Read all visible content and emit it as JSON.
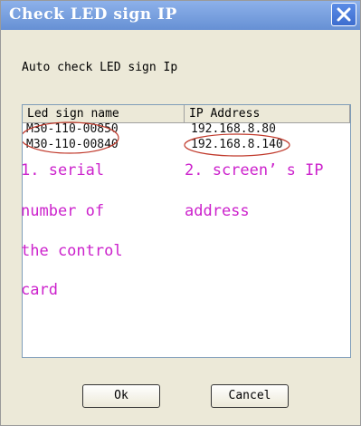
{
  "window": {
    "title": "Check LED sign IP"
  },
  "dialog": {
    "subtitle": "Auto check LED sign Ip"
  },
  "list": {
    "headers": [
      "Led sign name",
      "IP Address"
    ],
    "rows": [
      {
        "name": "M30-110-00850",
        "ip": "192.168.8.80"
      },
      {
        "name": "M30-110-00840",
        "ip": "192.168.8.140"
      }
    ]
  },
  "annotations": {
    "note1": [
      "1. serial",
      "number of",
      "the control",
      "card"
    ],
    "note2": [
      "2. screen’ s IP",
      "address"
    ],
    "color": "#cc22cc"
  },
  "buttons": {
    "ok": "Ok",
    "cancel": "Cancel"
  },
  "icons": {
    "close": "close-icon"
  }
}
